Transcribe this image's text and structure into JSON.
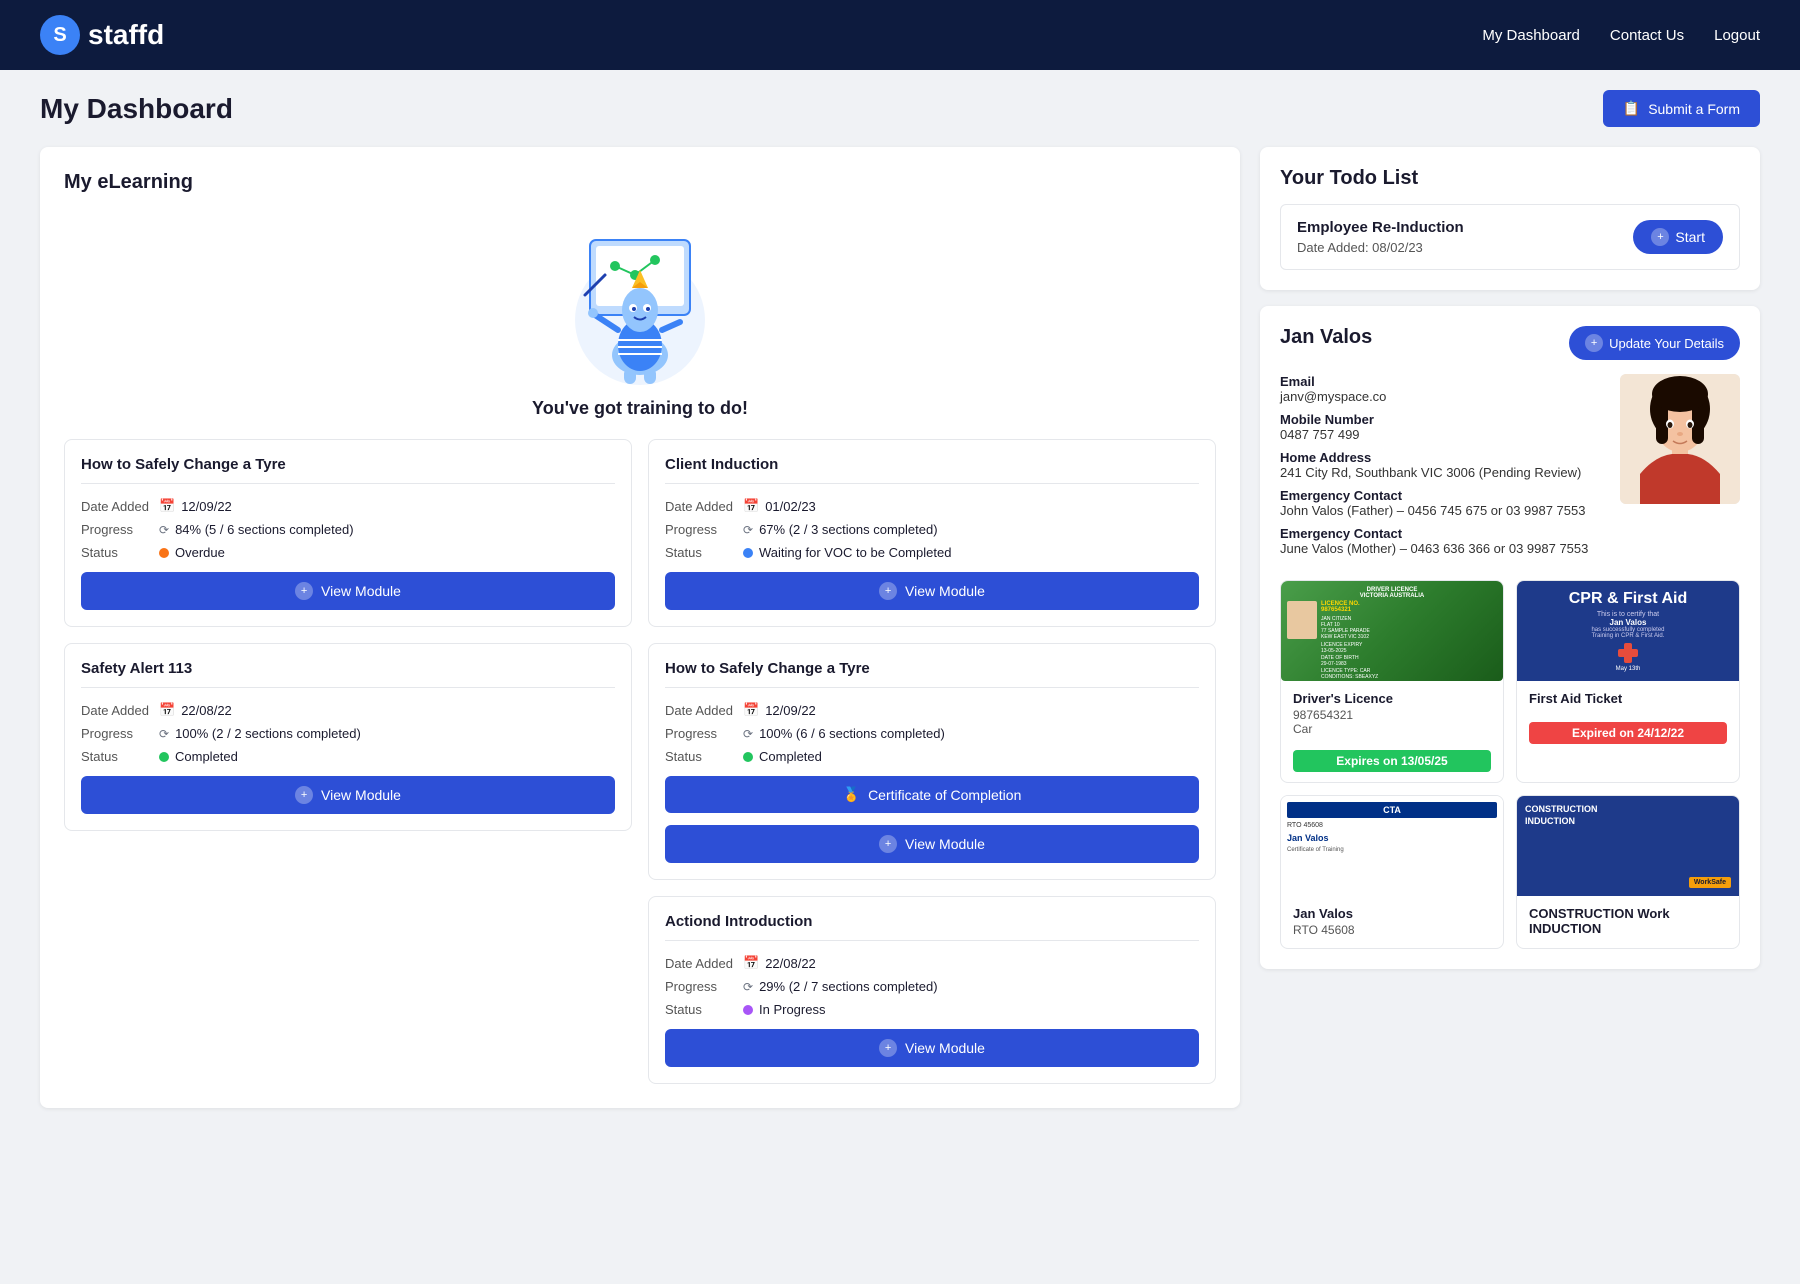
{
  "header": {
    "logo_text": "staffd",
    "nav": {
      "dashboard": "My Dashboard",
      "contact": "Contact Us",
      "logout": "Logout"
    }
  },
  "page": {
    "title": "My Dashboard",
    "submit_form_btn": "Submit a Form"
  },
  "elearning": {
    "section_title": "My eLearning",
    "mascot_caption": "You've got training to do!",
    "modules": [
      {
        "id": "tyre-left",
        "title": "How to Safely Change a Tyre",
        "date_added_label": "Date Added",
        "date_added": "12/09/22",
        "progress_label": "Progress",
        "progress": "84% (5 / 6 sections completed)",
        "status_label": "Status",
        "status": "Overdue",
        "status_color": "orange",
        "btn_label": "View Module"
      },
      {
        "id": "client-induction",
        "title": "Client Induction",
        "date_added_label": "Date Added",
        "date_added": "01/02/23",
        "progress_label": "Progress",
        "progress": "67% (2 / 3 sections completed)",
        "status_label": "Status",
        "status": "Waiting for VOC to be Completed",
        "status_color": "blue",
        "btn_label": "View Module",
        "span_rows": true
      },
      {
        "id": "tyre-right",
        "title": "How to Safely Change a Tyre",
        "date_added_label": "Date Added",
        "date_added": "12/09/22",
        "progress_label": "Progress",
        "progress": "100% (6 / 6 sections completed)",
        "status_label": "Status",
        "status": "Completed",
        "status_color": "green",
        "cert_btn": "Certificate of Completion",
        "btn_label": "View Module"
      },
      {
        "id": "safety-alert",
        "title": "Safety Alert 113",
        "date_added_label": "Date Added",
        "date_added": "22/08/22",
        "progress_label": "Progress",
        "progress": "100% (2 / 2 sections completed)",
        "status_label": "Status",
        "status": "Completed",
        "status_color": "green",
        "btn_label": "View Module"
      },
      {
        "id": "actiond",
        "title": "Actiond Introduction",
        "date_added_label": "Date Added",
        "date_added": "22/08/22",
        "progress_label": "Progress",
        "progress": "29% (2 / 7 sections completed)",
        "status_label": "Status",
        "status": "In Progress",
        "status_color": "purple",
        "btn_label": "View Module"
      }
    ]
  },
  "todo": {
    "section_title": "Your Todo List",
    "items": [
      {
        "title": "Employee Re-Induction",
        "date_label": "Date Added:",
        "date": "08/02/23",
        "btn_label": "Start"
      }
    ]
  },
  "profile": {
    "name": "Jan Valos",
    "update_btn": "Update Your Details",
    "fields": [
      {
        "label": "Email",
        "value": "janv@myspace.co"
      },
      {
        "label": "Mobile Number",
        "value": "0487 757 499"
      },
      {
        "label": "Home Address",
        "value": "241 City Rd, Southbank VIC 3006 (Pending Review)"
      },
      {
        "label": "Emergency Contact",
        "value": "John Valos (Father) – 0456 745 675 or 03 9987 7553"
      },
      {
        "label": "Emergency Contact",
        "value": "June Valos (Mother) – 0463 636 366 or 03 9987 7553"
      }
    ],
    "documents": [
      {
        "type": "driver-licence",
        "title": "Driver's Licence",
        "number": "987654321",
        "sub": "Car",
        "expiry": "Expires on 13/05/25",
        "expiry_color": "green"
      },
      {
        "type": "cpr",
        "title": "First Aid Ticket",
        "number": "",
        "sub": "",
        "expiry": "Expired on 24/12/22",
        "expiry_color": "red"
      },
      {
        "type": "cta",
        "title": "Jan Valos",
        "number": "RTO 45608",
        "sub": "",
        "expiry": "",
        "expiry_color": ""
      },
      {
        "type": "construction",
        "title": "CONSTRUCTION Work INDUCTION",
        "number": "",
        "sub": "",
        "expiry": "",
        "expiry_color": ""
      }
    ]
  }
}
